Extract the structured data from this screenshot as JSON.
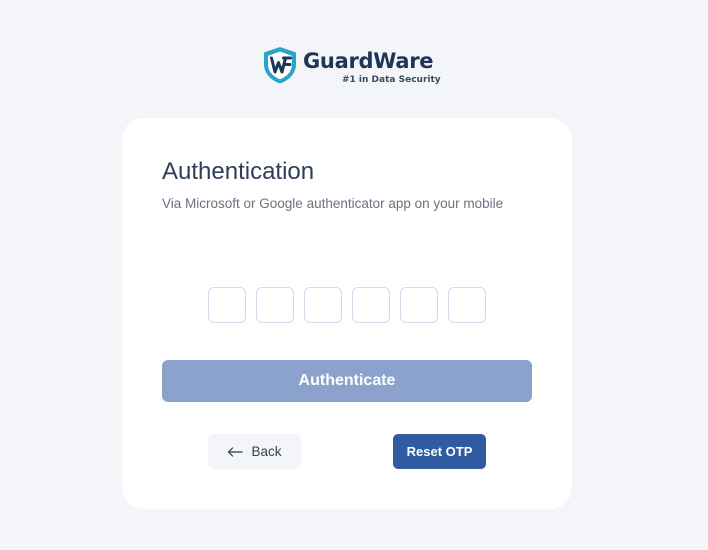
{
  "brand": {
    "name": "GuardWare",
    "tagline": "#1 in Data Security",
    "logo_icon": "shield-w-icon",
    "colors": {
      "navy": "#1d3557",
      "teal": "#2aa3c9"
    }
  },
  "auth": {
    "title": "Authentication",
    "subtitle": "Via Microsoft or Google authenticator app on your mobile",
    "otp": {
      "length": 6,
      "values": [
        "",
        "",
        "",
        "",
        "",
        ""
      ]
    },
    "authenticate_label": "Authenticate",
    "back_label": "Back",
    "back_icon": "arrow-left-icon",
    "reset_label": "Reset OTP"
  },
  "colors": {
    "background": "#f4f5f9",
    "card": "#ffffff",
    "authenticate_disabled": "#8ba3cc",
    "reset_button": "#2f5ba3",
    "back_button": "#f3f5f9"
  }
}
